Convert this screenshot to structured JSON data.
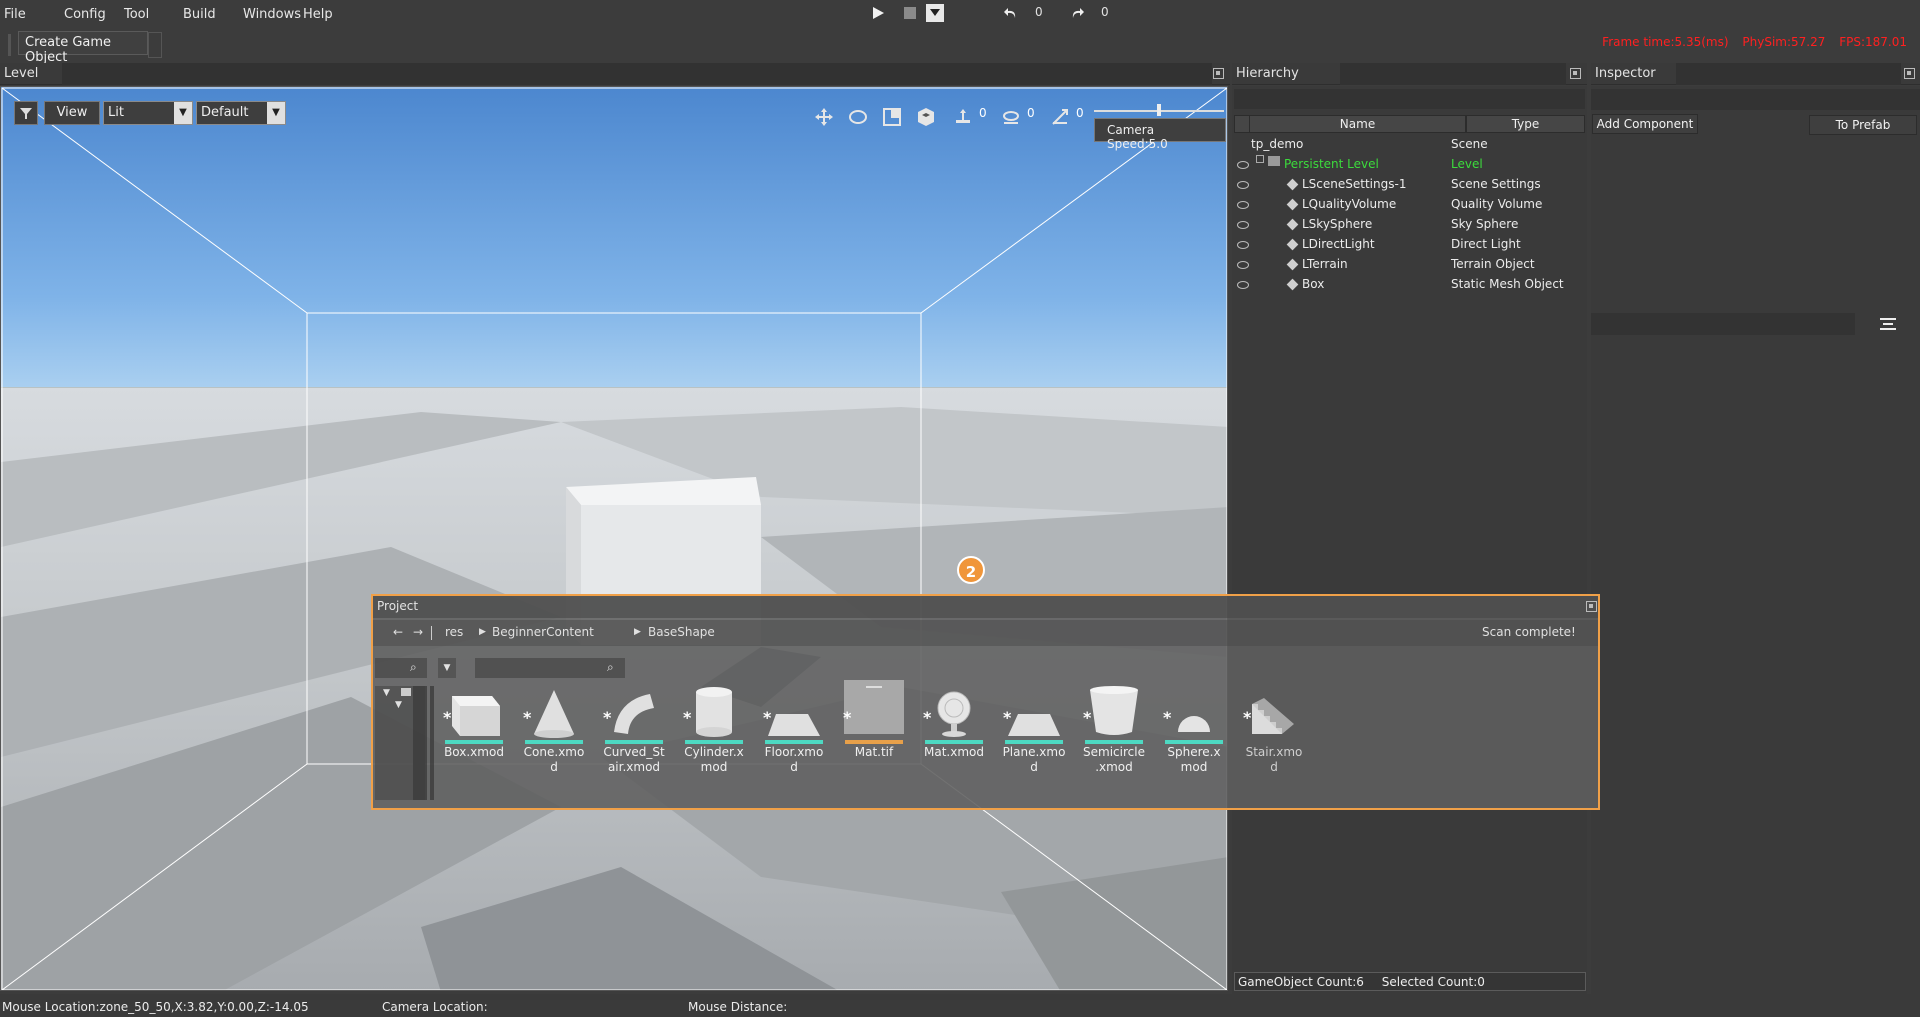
{
  "menu": {
    "file": "File",
    "config": "Config",
    "tool": "Tool",
    "build": "Build",
    "windows": "Windows",
    "help": "Help"
  },
  "playbar": {
    "undo_count": "0",
    "redo_count": "0"
  },
  "toolbar": {
    "create_game_object": "Create Game Object"
  },
  "stats": {
    "frame_time": "Frame time:5.35(ms)",
    "phys_sim": "PhySim:57.27",
    "fps": "FPS:187.01"
  },
  "level": {
    "title": "Level",
    "view_button": "View",
    "lit_select": "Lit",
    "default_select": "Default",
    "gizmo_counts": [
      "0",
      "0",
      "0"
    ],
    "camera_speed": "Camera Speed:5.0"
  },
  "hierarchy": {
    "title": "Hierarchy",
    "columns": {
      "name": "Name",
      "type": "Type"
    },
    "rows": [
      {
        "name": "tp_demo",
        "type": "Scene"
      },
      {
        "name": "Persistent Level",
        "type": "Level"
      },
      {
        "name": "LSceneSettings-1",
        "type": "Scene Settings"
      },
      {
        "name": "LQualityVolume",
        "type": "Quality Volume"
      },
      {
        "name": "LSkySphere",
        "type": "Sky Sphere"
      },
      {
        "name": "LDirectLight",
        "type": "Direct Light"
      },
      {
        "name": "LTerrain",
        "type": "Terrain Object"
      },
      {
        "name": "Box",
        "type": "Static Mesh Object"
      }
    ],
    "footer": {
      "gameobject_count": "GameObject Count:6",
      "selected_count": "Selected Count:0"
    }
  },
  "inspector": {
    "title": "Inspector",
    "add_component": "Add Component",
    "to_prefab": "To Prefab"
  },
  "project": {
    "title": "Project",
    "breadcrumb": [
      "res",
      "BeginnerContent",
      "BaseShape"
    ],
    "status": "Scan complete!",
    "assets": [
      {
        "line1": "Box.xmod",
        "line2": ""
      },
      {
        "line1": "Cone.xmo",
        "line2": "d"
      },
      {
        "line1": "Curved_St",
        "line2": "air.xmod"
      },
      {
        "line1": "Cylinder.x",
        "line2": "mod"
      },
      {
        "line1": "Floor.xmo",
        "line2": "d"
      },
      {
        "line1": "Mat.tif",
        "line2": ""
      },
      {
        "line1": "Mat.xmod",
        "line2": ""
      },
      {
        "line1": "Plane.xmo",
        "line2": "d"
      },
      {
        "line1": "Semicircle",
        "line2": ".xmod"
      },
      {
        "line1": "Sphere.x",
        "line2": "mod"
      },
      {
        "line1": "Stair.xmo",
        "line2": "d"
      }
    ]
  },
  "badge": "2",
  "status": {
    "mouse_location": "Mouse Location:zone_50_50,X:3.82,Y:0.00,Z:-14.05",
    "camera_location": "Camera Location:",
    "mouse_distance": "Mouse Distance:"
  },
  "colors": {
    "highlight": "#f0a048",
    "level_green": "#3cdc3c",
    "stats_red": "#ff2020",
    "asset_bar": "#4dd9c2",
    "mat_bar": "#e7a04a"
  }
}
